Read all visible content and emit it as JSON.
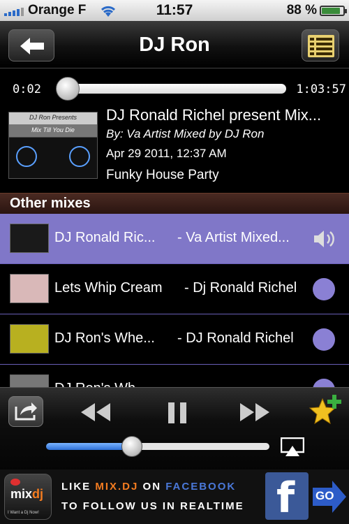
{
  "status_bar": {
    "carrier": "Orange F",
    "time": "11:57",
    "battery_text": "88 %",
    "battery_level": 0.88
  },
  "nav": {
    "title": "DJ Ron",
    "back_icon": "back-arrow-icon",
    "list_icon": "list-icon"
  },
  "progress": {
    "current": "0:02",
    "total": "1:03:57",
    "fraction": 0.0
  },
  "now_playing": {
    "art_caption_top": "DJ Ron Presents",
    "art_caption_bottom": "Mix Till You Die",
    "title": "DJ Ronald Richel present Mix...",
    "artist": "By: Va Artist Mixed by DJ Ron",
    "date": "Apr 29 2011, 12:37 AM",
    "genre": "Funky House Party"
  },
  "section": {
    "title": "Other mixes"
  },
  "mixes": [
    {
      "title": "DJ Ronald Ric...",
      "subtitle": "- Va Artist Mixed...",
      "selected": true,
      "thumb_color": "#1a1a1a"
    },
    {
      "title": "Lets Whip Cream",
      "subtitle": "- Dj Ronald Richel",
      "selected": false,
      "thumb_color": "#d9b8b8"
    },
    {
      "title": "DJ Ron's Whe...",
      "subtitle": "- DJ Ronald Richel",
      "selected": false,
      "thumb_color": "#b8b020"
    },
    {
      "title": "DJ Ron's Wh...",
      "subtitle": "",
      "selected": false,
      "thumb_color": "#777777"
    }
  ],
  "volume": {
    "level": 0.36
  },
  "banner": {
    "logo_text_mix": "mix",
    "logo_text_dj": "dj",
    "logo_tagline": "I Want a Dj Now!",
    "like_prefix": "LIKE ",
    "like_brand": "MIX.DJ",
    "like_on": " ON ",
    "like_network": "FACEBOOK",
    "line2": "TO FOLLOW US IN REALTIME",
    "fb_letter": "f",
    "go_label": "GO"
  },
  "colors": {
    "selected_row": "#8077c8",
    "row_divider": "#6a5fb8",
    "section_header": "#4a2a22",
    "brand_orange": "#f47c20",
    "facebook_blue": "#3b5998"
  }
}
